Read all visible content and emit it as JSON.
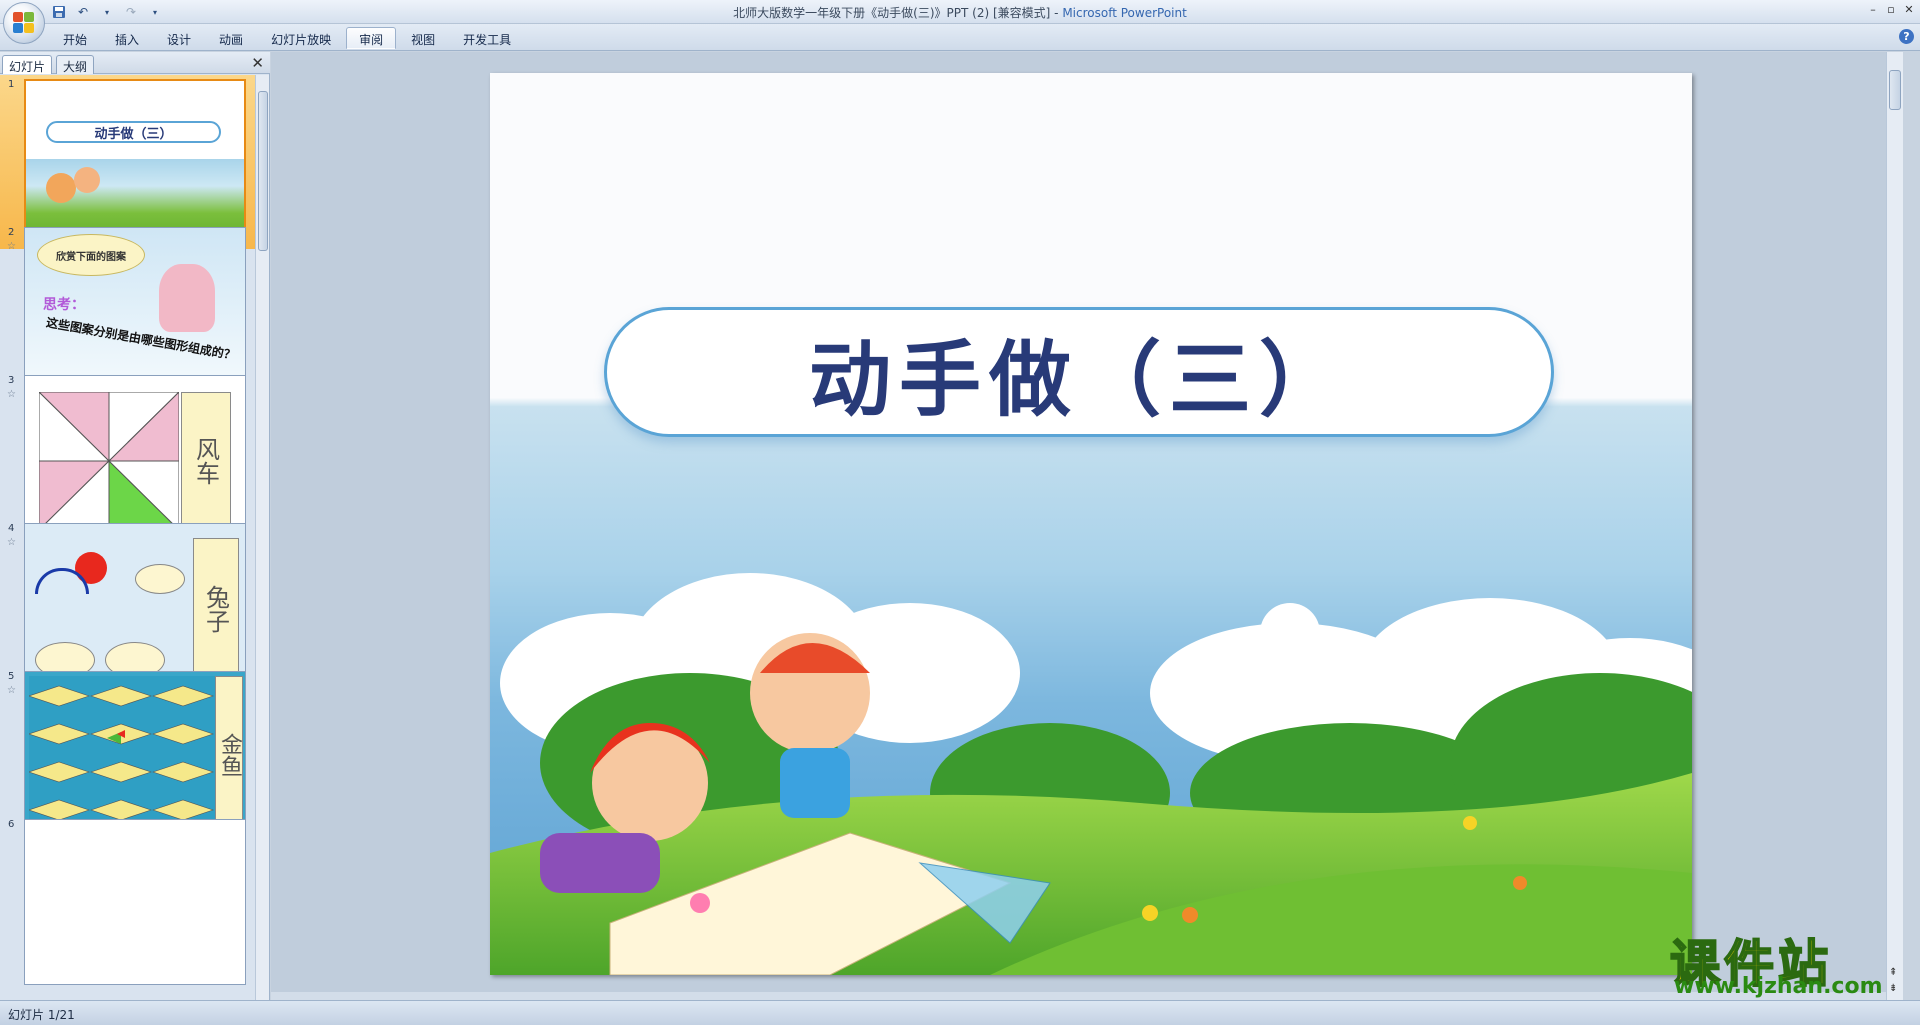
{
  "window": {
    "title": "北师大版数学一年级下册《动手做(三)》PPT (2) [兼容模式] -",
    "app_name": "Microsoft PowerPoint"
  },
  "ribbon": {
    "tabs": [
      {
        "label": "开始"
      },
      {
        "label": "插入"
      },
      {
        "label": "设计"
      },
      {
        "label": "动画"
      },
      {
        "label": "幻灯片放映"
      },
      {
        "label": "审阅",
        "active": true
      },
      {
        "label": "视图"
      },
      {
        "label": "开发工具"
      }
    ],
    "help": "?"
  },
  "left_pane": {
    "tabs": [
      "幻灯片",
      "大纲"
    ],
    "slides": [
      {
        "num": "1",
        "label": "动手做（三）"
      },
      {
        "num": "2",
        "cloud_text": "欣赏下面的图案",
        "think": "思考：",
        "question": "这些图案分别是由哪些图形组成的？"
      },
      {
        "num": "3",
        "caption": "风车"
      },
      {
        "num": "4",
        "caption": "兔子"
      },
      {
        "num": "5",
        "caption": "金鱼"
      },
      {
        "num": "6"
      }
    ]
  },
  "slide": {
    "title": "动手做（三）"
  },
  "statusbar": {
    "text": "幻灯片 1/21"
  },
  "watermark": {
    "title": "课件站",
    "url": "www.kjzhan.com"
  },
  "colors": {
    "title_text": "#283a78",
    "title_border": "#5aa4d6",
    "selected_thumb": "#f7b74b"
  }
}
